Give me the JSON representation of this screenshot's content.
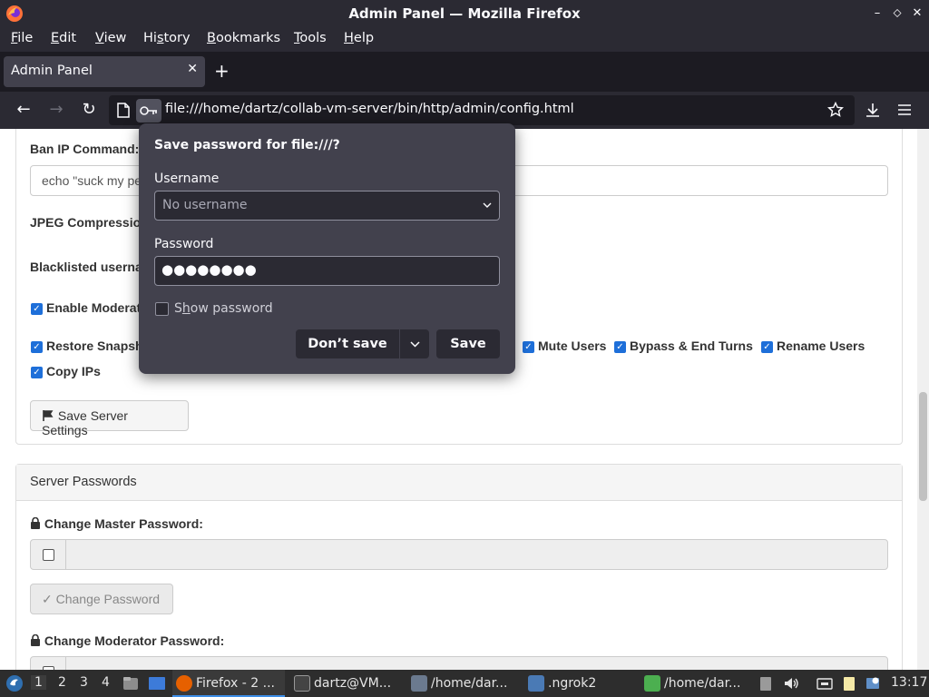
{
  "window": {
    "title": "Admin Panel — Mozilla Firefox",
    "controls": {
      "minimize": "–",
      "maximize": "⬦",
      "close": "✕"
    }
  },
  "menubar": {
    "items": [
      {
        "label": "File",
        "accel": "F",
        "rest": "ile"
      },
      {
        "label": "Edit",
        "accel": "E",
        "rest": "dit"
      },
      {
        "label": "View",
        "accel": "V",
        "rest": "iew"
      },
      {
        "label": "History",
        "accel": "s",
        "pre": "Hi",
        "rest": "tory"
      },
      {
        "label": "Bookmarks",
        "accel": "B",
        "rest": "ookmarks"
      },
      {
        "label": "Tools",
        "accel": "T",
        "rest": "ools"
      },
      {
        "label": "Help",
        "accel": "H",
        "rest": "elp"
      }
    ]
  },
  "tabs": [
    {
      "title": "Admin Panel",
      "close": "✕"
    }
  ],
  "newtab": "+",
  "navbar": {
    "back": "←",
    "forward": "→",
    "reload": "↻",
    "url": "file:///home/dartz/collab-vm-server/bin/http/admin/config.html"
  },
  "page": {
    "ban_ip_label": "Ban IP Command:",
    "ban_ip_value": "echo \"suck my pe",
    "jpeg_label": "JPEG Compressio",
    "blacklisted_label": "Blacklisted userna",
    "enable_moderator_label": "Enable Moderat",
    "restore_snapshot_label": "Restore Snapsh",
    "mute_users_label": "Mute Users",
    "bypass_label": "Bypass & End Turns",
    "rename_users_label": "Rename Users",
    "copy_ips_label": "Copy IPs",
    "save_settings_button": "Save Server Settings",
    "passwords_heading": "Server Passwords",
    "change_master_label": "Change Master Password:",
    "change_password_button": "Change Password",
    "change_moderator_label": "Change Moderator Password:",
    "checkmark": "✓",
    "lock": "🔒"
  },
  "password_popup": {
    "title": "Save password for file:///?",
    "username_label": "Username",
    "username_placeholder": "No username",
    "password_label": "Password",
    "password_dots": "●●●●●●●●",
    "show_password": "Show password",
    "show_password_accel": "h",
    "dont_save": "Don’t save",
    "save": "Save"
  },
  "taskbar": {
    "workspaces": [
      "1",
      "2",
      "3",
      "4"
    ],
    "tasks": [
      {
        "label": "Firefox - 2 ...",
        "color": "#e66000"
      },
      {
        "label": "dartz@VM...",
        "color": "#444444"
      },
      {
        "label": "/home/dar...",
        "color": "#6b7a8f"
      },
      {
        "label": ".ngrok2",
        "color": "#4a7ab5"
      },
      {
        "label": "/home/dar...",
        "color": "#4caf50"
      }
    ],
    "clock": "13:17"
  },
  "colors": {
    "accent": "#1e6fd9",
    "popup_bg": "#42414d",
    "chrome_bg": "#2b2a33"
  }
}
